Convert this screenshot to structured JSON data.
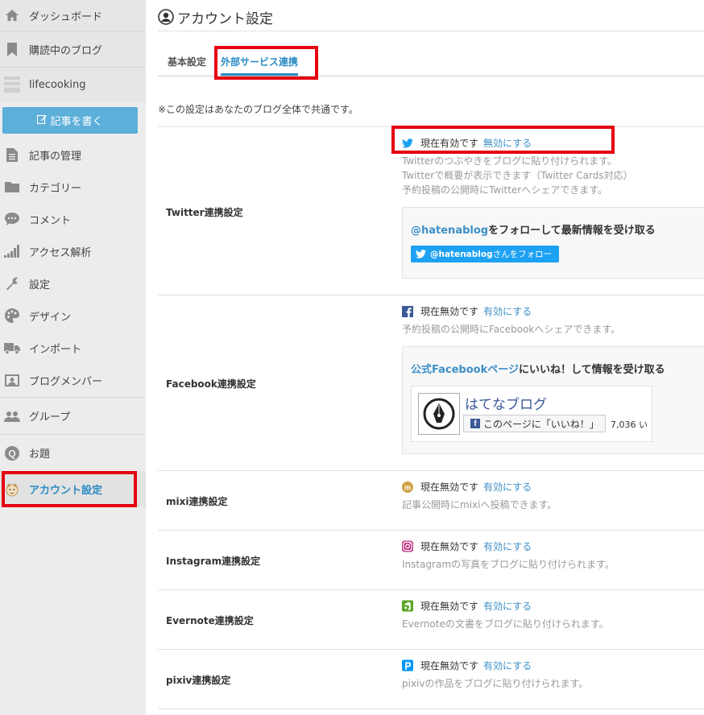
{
  "sidebar": {
    "items_top": [
      {
        "label": "ダッシュボード",
        "icon": "home-icon"
      },
      {
        "label": "購読中のブログ",
        "icon": "bookmark-icon"
      }
    ],
    "blog_name": "lifecooking",
    "write_button": "記事を書く",
    "items": [
      {
        "label": "記事の管理",
        "icon": "document-icon"
      },
      {
        "label": "カテゴリー",
        "icon": "folder-icon"
      },
      {
        "label": "コメント",
        "icon": "comment-icon"
      },
      {
        "label": "アクセス解析",
        "icon": "bar-chart-icon"
      },
      {
        "label": "設定",
        "icon": "wrench-icon"
      },
      {
        "label": "デザイン",
        "icon": "palette-icon"
      },
      {
        "label": "インポート",
        "icon": "truck-icon"
      },
      {
        "label": "ブログメンバー",
        "icon": "member-card-icon"
      }
    ],
    "group": {
      "label": "グループ",
      "icon": "group-icon"
    },
    "odai": {
      "label": "お題",
      "icon": "odai-icon"
    },
    "account": {
      "label": "アカウント設定",
      "icon": "avatar-icon"
    }
  },
  "main": {
    "title": "アカウント設定",
    "tabs": [
      {
        "label": "基本設定",
        "active": false
      },
      {
        "label": "外部サービス連携",
        "active": true
      }
    ],
    "note": "※この設定はあなたのブログ全体で共通です。",
    "services": {
      "twitter": {
        "label": "Twitter連携設定",
        "status": "現在有効です",
        "action": "無効にする",
        "desc": [
          "Twitterのつぶやきをブログに貼り付けられます。",
          "Twitterで概要が表示できます（Twitter Cards対応）",
          "予約投稿の公開時にTwitterへシェアできます。"
        ],
        "promo_link": "@hatenablog",
        "promo_text": "をフォローして最新情報を受け取る",
        "follow_handle": "@hatenablog",
        "follow_suffix": "さんをフォロー"
      },
      "facebook": {
        "label": "Facebook連携設定",
        "status": "現在無効です",
        "action": "有効にする",
        "desc": [
          "予約投稿の公開時にFacebookへシェアできます。"
        ],
        "promo_link": "公式Facebookページ",
        "promo_text": "にいいね！して情報を受け取る",
        "page_name": "はてなブログ",
        "like_label": "このページに「いいね！」",
        "like_count": "7,036 い"
      },
      "mixi": {
        "label": "mixi連携設定",
        "status": "現在無効です",
        "action": "有効にする",
        "desc": "記事公開時にmixiへ投稿できます。"
      },
      "instagram": {
        "label": "Instagram連携設定",
        "status": "現在無効です",
        "action": "有効にする",
        "desc": "Instagramの写真をブログに貼り付けられます。"
      },
      "evernote": {
        "label": "Evernote連携設定",
        "status": "現在無効です",
        "action": "有効にする",
        "desc": "Evernoteの文書をブログに貼り付けられます。"
      },
      "pixiv": {
        "label": "pixiv連携設定",
        "status": "現在無効です",
        "action": "有効にする",
        "desc": "pixivの作品をブログに貼り付けられます。"
      }
    }
  },
  "colors": {
    "accent": "#2b8bc3",
    "link": "#3d8fc7",
    "highlight": "#e60012",
    "write_button": "#5cafd9",
    "twitter": "#1da1f2",
    "facebook": "#3b5998"
  }
}
